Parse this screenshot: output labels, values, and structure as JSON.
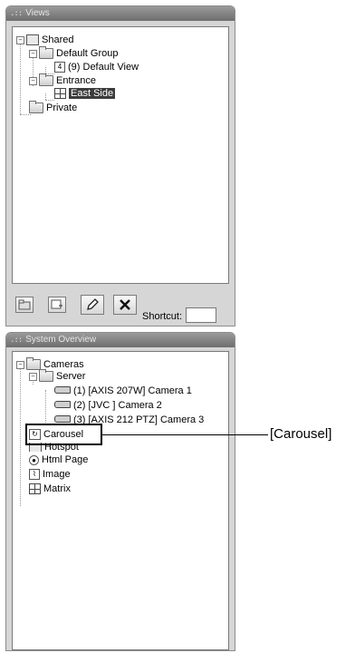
{
  "views_panel": {
    "title": "Views",
    "tree": {
      "shared": "Shared",
      "default_group": "Default Group",
      "default_view_num": "4",
      "default_view": "(9) Default View",
      "entrance": "Entrance",
      "east_side": "East Side",
      "private": "Private"
    },
    "toolbar": {
      "new_group_icon": "new-folder-icon",
      "new_view_icon": "new-view-icon",
      "edit_icon": "pencil-icon",
      "delete_icon": "delete-x-icon"
    },
    "shortcut_label": "Shortcut:",
    "shortcut_value": ""
  },
  "system_panel": {
    "title": "System Overview",
    "tree": {
      "cameras": "Cameras",
      "server": "Server",
      "camera1": "(1) [AXIS 207W] Camera 1",
      "camera2": "(2) [JVC ] Camera 2",
      "camera3": "(3) [AXIS 212 PTZ] Camera 3",
      "carousel": "Carousel",
      "hotspot": "Hotspot",
      "html_page": "Html Page",
      "image": "Image",
      "matrix": "Matrix"
    }
  },
  "callout": {
    "label": "[Carousel]"
  }
}
